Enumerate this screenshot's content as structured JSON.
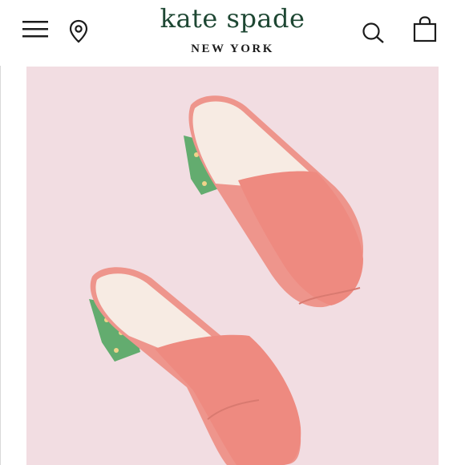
{
  "header": {
    "brand_title": "kate spade",
    "brand_subtitle": "NEW YORK",
    "icons": {
      "menu": "hamburger-menu-icon",
      "location": "map-pin-icon",
      "search": "search-icon",
      "bag": "shopping-bag-icon"
    }
  },
  "hero": {
    "background_color": "#f2dde2",
    "product_color": "#ef8f86",
    "heel_color": "#4aa35a"
  },
  "colors": {
    "brand": "#1e4733",
    "text": "#1c1c1c"
  }
}
